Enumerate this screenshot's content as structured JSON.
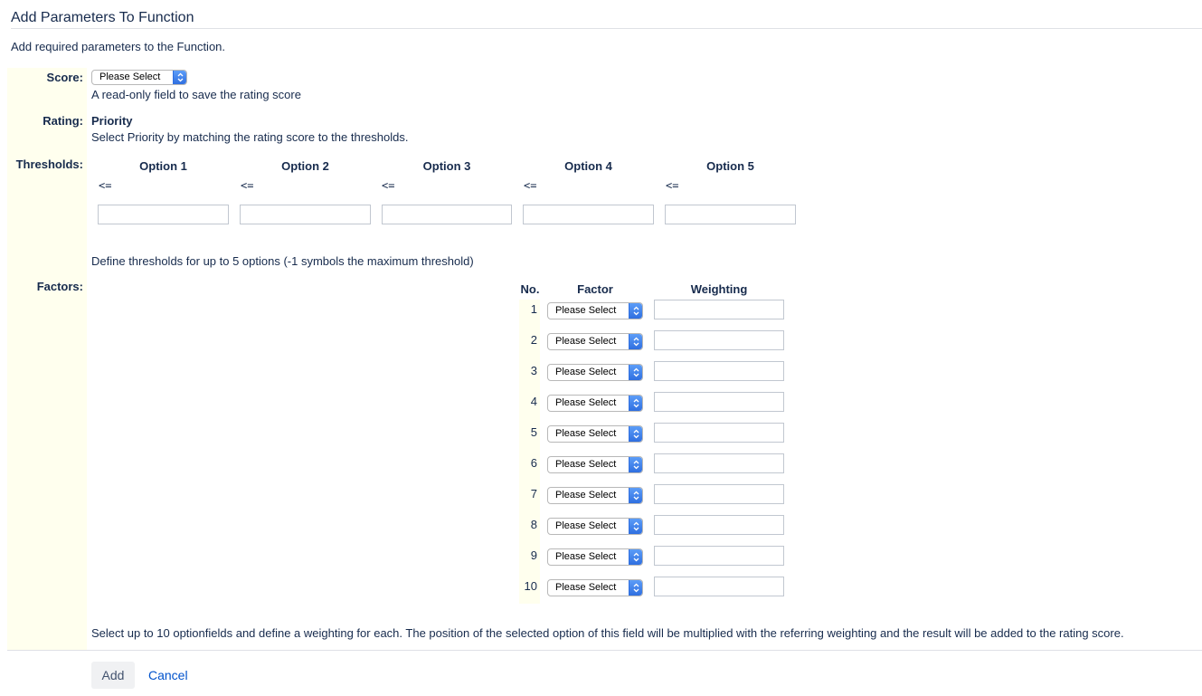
{
  "page": {
    "title": "Add Parameters To Function",
    "description": "Add required parameters to the Function."
  },
  "score": {
    "label": "Score:",
    "select_value": "Please Select",
    "help": "A read-only field to save the rating score"
  },
  "rating": {
    "label": "Rating:",
    "value": "Priority",
    "help": "Select Priority by matching the rating score to the thresholds."
  },
  "thresholds": {
    "label": "Thresholds:",
    "options": [
      {
        "header": "Option 1",
        "operator": "<=",
        "value": ""
      },
      {
        "header": "Option 2",
        "operator": "<=",
        "value": ""
      },
      {
        "header": "Option 3",
        "operator": "<=",
        "value": ""
      },
      {
        "header": "Option 4",
        "operator": "<=",
        "value": ""
      },
      {
        "header": "Option 5",
        "operator": "<=",
        "value": ""
      }
    ],
    "help": "Define thresholds for up to 5 options (-1 symbols the maximum threshold)"
  },
  "factors": {
    "label": "Factors:",
    "headers": {
      "no": "No.",
      "factor": "Factor",
      "weighting": "Weighting"
    },
    "rows": [
      {
        "no": "1",
        "factor": "Please Select",
        "weighting": ""
      },
      {
        "no": "2",
        "factor": "Please Select",
        "weighting": ""
      },
      {
        "no": "3",
        "factor": "Please Select",
        "weighting": ""
      },
      {
        "no": "4",
        "factor": "Please Select",
        "weighting": ""
      },
      {
        "no": "5",
        "factor": "Please Select",
        "weighting": ""
      },
      {
        "no": "6",
        "factor": "Please Select",
        "weighting": ""
      },
      {
        "no": "7",
        "factor": "Please Select",
        "weighting": ""
      },
      {
        "no": "8",
        "factor": "Please Select",
        "weighting": ""
      },
      {
        "no": "9",
        "factor": "Please Select",
        "weighting": ""
      },
      {
        "no": "10",
        "factor": "Please Select",
        "weighting": ""
      }
    ],
    "help": "Select up to 10 optionfields and define a weighting for each. The position of the selected option of this field will be multiplied with the referring weighting and the result will be added to the rating score."
  },
  "actions": {
    "add_label": "Add",
    "cancel_label": "Cancel"
  },
  "icons": {
    "select_arrows": "select-updown-icon"
  },
  "colors": {
    "label_column_bg": "#ffffee",
    "link": "#0052cc",
    "text": "#172b4d",
    "select_accent": "#2f6fe0"
  }
}
